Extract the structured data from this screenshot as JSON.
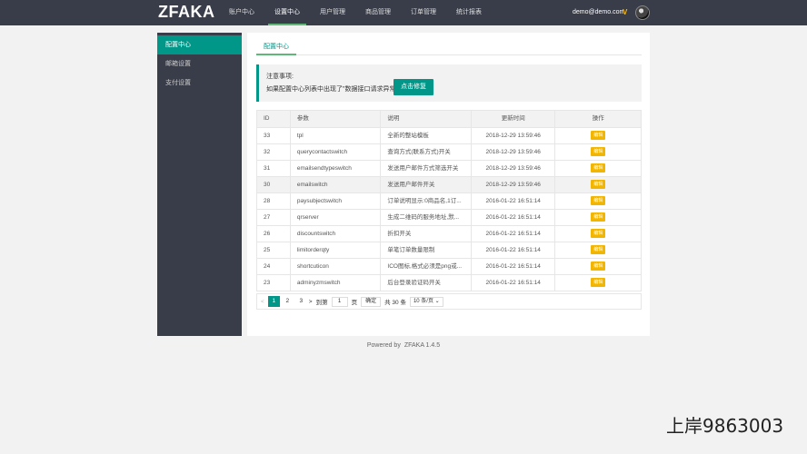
{
  "header": {
    "logo": "ZFAKA",
    "nav": [
      "账户中心",
      "设置中心",
      "用户管理",
      "商品管理",
      "订单管理",
      "统计报表"
    ],
    "active_nav": 1,
    "user_email": "demo@demo.com",
    "vip_badge": "V"
  },
  "sidebar": {
    "items": [
      {
        "label": "配置中心",
        "active": true
      },
      {
        "label": "邮箱设置",
        "active": false
      },
      {
        "label": "支付设置",
        "active": false
      }
    ]
  },
  "main": {
    "tab": "配置中心",
    "notice_title": "注意事项:",
    "notice_text": "如果配置中心列表中出现了\"数据接口请求异常\",",
    "fix_button": "点击修复"
  },
  "table": {
    "headers": [
      "ID",
      "参数",
      "说明",
      "更新时间",
      "操作"
    ],
    "rows": [
      {
        "id": "33",
        "param": "tpl",
        "desc": "全新的整站模板",
        "time": "2018-12-29 13:59:46",
        "op": "编辑"
      },
      {
        "id": "32",
        "param": "querycontactswitch",
        "desc": "查询方式(联系方式)开关",
        "time": "2018-12-29 13:59:46",
        "op": "编辑"
      },
      {
        "id": "31",
        "param": "emailsendtypeswitch",
        "desc": "发送用户邮件方式筛选开关",
        "time": "2018-12-29 13:59:46",
        "op": "编辑"
      },
      {
        "id": "30",
        "param": "emailswitch",
        "desc": "发送用户邮件开关",
        "time": "2018-12-29 13:59:46",
        "op": "编辑"
      },
      {
        "id": "28",
        "param": "paysubjectswitch",
        "desc": "订单说明显示:0商品名,1订...",
        "time": "2016-01-22 16:51:14",
        "op": "编辑"
      },
      {
        "id": "27",
        "param": "qrserver",
        "desc": "生成二维码的服务地址,默...",
        "time": "2016-01-22 16:51:14",
        "op": "编辑"
      },
      {
        "id": "26",
        "param": "discountswitch",
        "desc": "折扣开关",
        "time": "2016-01-22 16:51:14",
        "op": "编辑"
      },
      {
        "id": "25",
        "param": "limitorderqty",
        "desc": "单笔订单数量限制",
        "time": "2016-01-22 16:51:14",
        "op": "编辑"
      },
      {
        "id": "24",
        "param": "shortcuticon",
        "desc": "ICO图标,格式必须是png或...",
        "time": "2016-01-22 16:51:14",
        "op": "编辑"
      },
      {
        "id": "23",
        "param": "adminyzmswitch",
        "desc": "后台登录验证码开关",
        "time": "2016-01-22 16:51:14",
        "op": "编辑"
      }
    ],
    "highlight_row": 3
  },
  "pager": {
    "prev": "<",
    "pages": [
      "1",
      "2",
      "3"
    ],
    "current": "1",
    "next": ">",
    "goto_label": "到第",
    "goto_value": "1",
    "page_unit": "页",
    "confirm": "确定",
    "total": "共 30 条",
    "page_size": "10 条/页"
  },
  "footer": {
    "powered": "Powered by",
    "version": "ZFAKA 1.4.5"
  },
  "watermark": "上岸9863003",
  "colors": {
    "topbar": "#393d49",
    "accent": "#009688",
    "edit": "#f2b600"
  }
}
